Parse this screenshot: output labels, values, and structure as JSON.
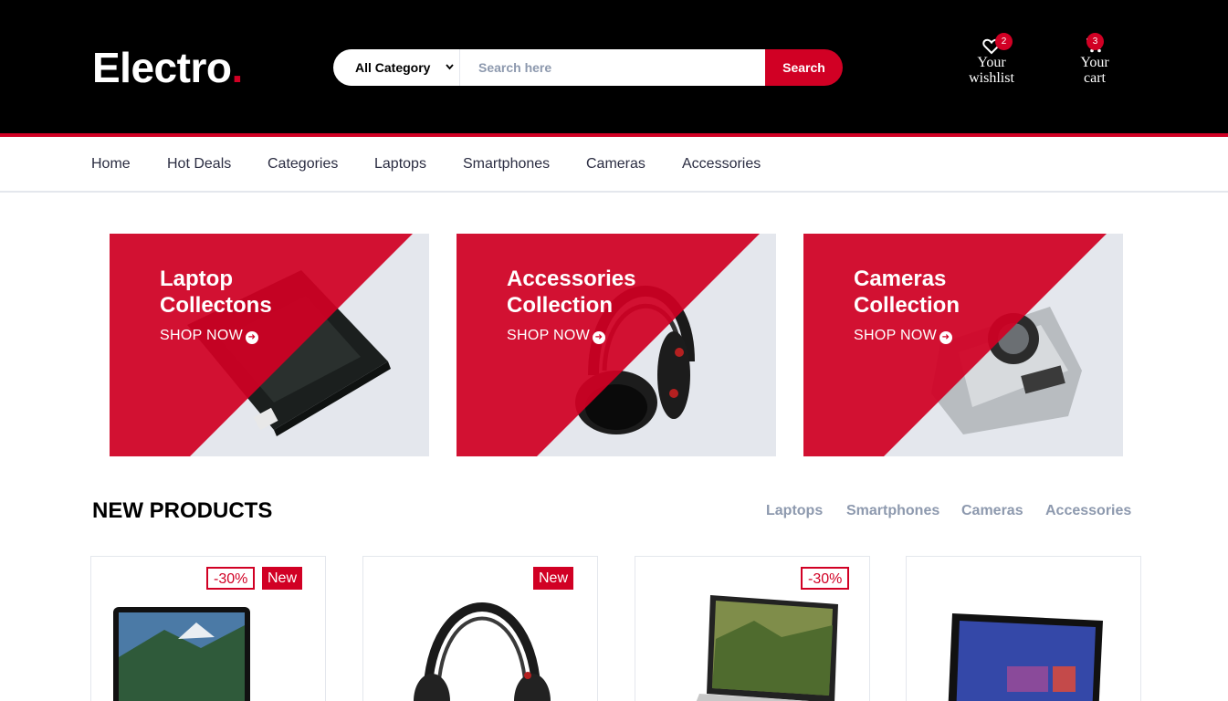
{
  "header": {
    "logo_text": "Electro",
    "logo_dot": ".",
    "search": {
      "category_selected": "All Category",
      "placeholder": "Search here",
      "button": "Search"
    },
    "wishlist": {
      "label_line1": "Your",
      "label_line2": "wishlist",
      "count": "2",
      "icon": "heart-icon"
    },
    "cart": {
      "label_line1": "Your",
      "label_line2": "cart",
      "count": "3",
      "icon": "cart-icon"
    }
  },
  "nav": [
    "Home",
    "Hot Deals",
    "Categories",
    "Laptops",
    "Smartphones",
    "Cameras",
    "Accessories"
  ],
  "collections": [
    {
      "title_line1": "Laptop",
      "title_line2": "Collectons",
      "cta": "SHOP NOW"
    },
    {
      "title_line1": "Accessories",
      "title_line2": "Collection",
      "cta": "SHOP NOW"
    },
    {
      "title_line1": "Cameras",
      "title_line2": "Collection",
      "cta": "SHOP NOW"
    }
  ],
  "new_products": {
    "title": "NEW PRODUCTS",
    "tabs": [
      "Laptops",
      "Smartphones",
      "Cameras",
      "Accessories"
    ],
    "items": [
      {
        "sale": "-30%",
        "badge": "New"
      },
      {
        "sale": "",
        "badge": "New"
      },
      {
        "sale": "-30%",
        "badge": ""
      },
      {
        "sale": "",
        "badge": ""
      }
    ]
  },
  "colors": {
    "accent": "#d10024",
    "header_bg": "#000000",
    "muted": "#8d99ae",
    "panel": "#e4e7ed"
  }
}
